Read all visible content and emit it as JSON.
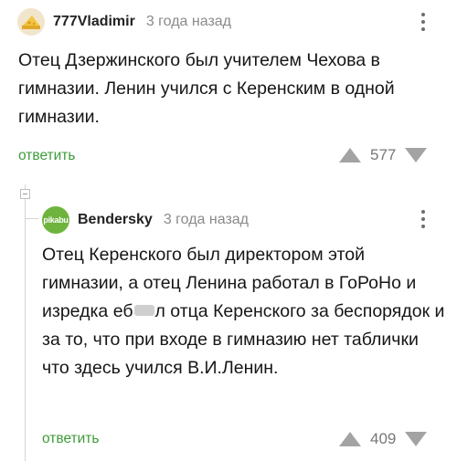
{
  "comments": [
    {
      "author": "777Vladimir",
      "time": "3 года назад",
      "text": "Отец Дзержинского был учителем Чехова в гимназии. Ленин учился с Керенским в одной гимназии.",
      "reply_label": "ответить",
      "rating": "577",
      "avatar_icon": "cheese-icon"
    },
    {
      "author": "Bendersky",
      "time": "3 года назад",
      "avatar_text": "pikabu",
      "text_before_censor": "Отец Керенского был директором этой гимназии, а отец Ленина работал в ГоРоНо и изредка еб",
      "text_after_censor": "л отца Керенского за беспорядок и за то, что при входе в гимназию нет таблички что здесь учился В.И.Ленин.",
      "reply_label": "ответить",
      "rating": "409"
    }
  ],
  "colors": {
    "accent": "#3e9b3a",
    "muted": "#8a8a8a",
    "thread": "#d4d4d4"
  }
}
